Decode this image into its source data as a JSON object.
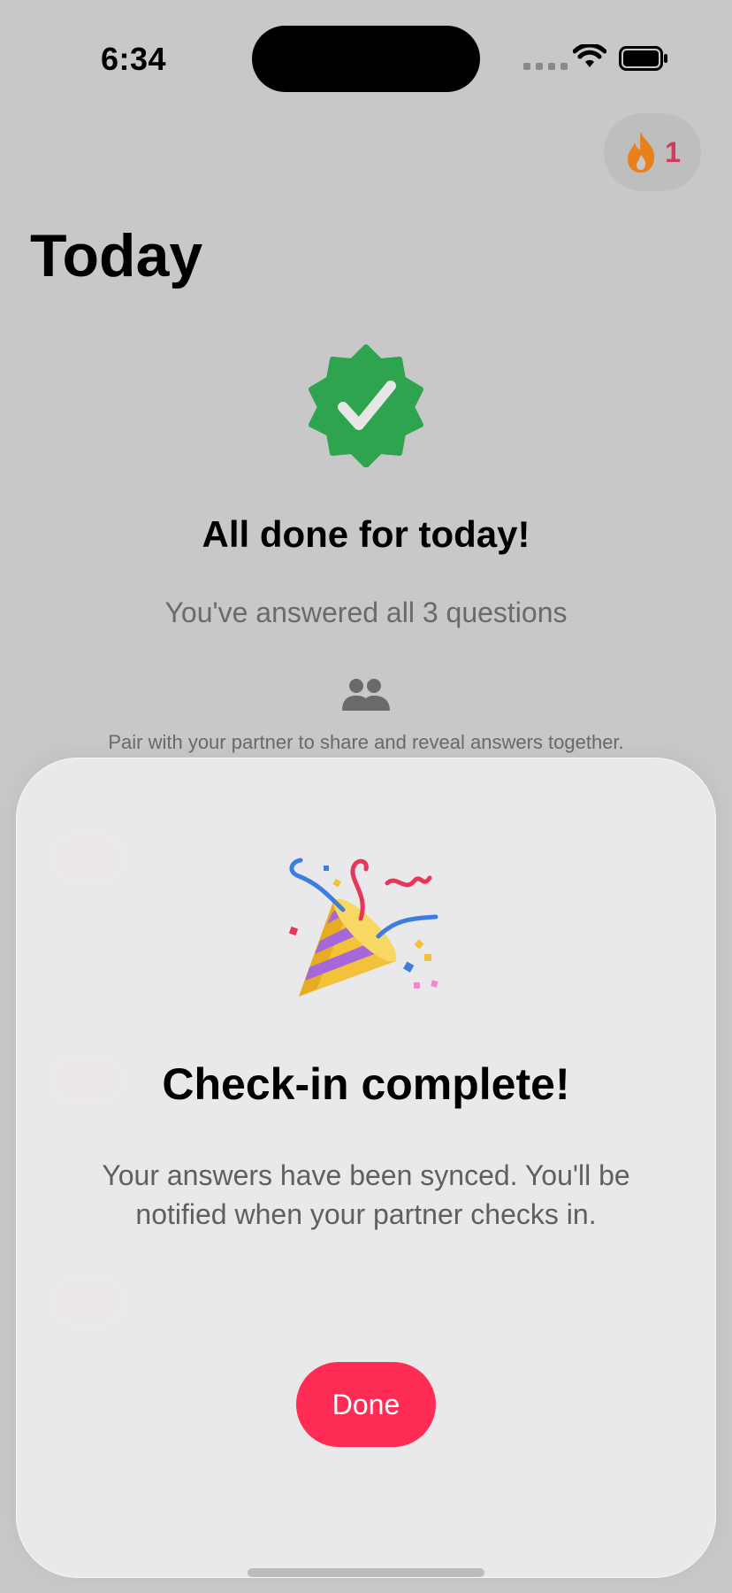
{
  "status_bar": {
    "time": "6:34"
  },
  "streak": {
    "icon": "flame-icon",
    "count": "1"
  },
  "page": {
    "title": "Today"
  },
  "summary": {
    "badge_icon": "checkmark-seal-icon",
    "heading": "All done for today!",
    "subtitle": "You've answered all 3 questions",
    "pair_icon": "people-icon",
    "pair_text": "Pair with your partner to share and reveal answers together."
  },
  "sheet": {
    "emoji": "party-popper-icon",
    "title": "Check-in complete!",
    "message": "Your answers have been synced. You'll be notified when your partner checks in.",
    "done_label": "Done"
  },
  "colors": {
    "accent": "#ff2d55",
    "success": "#2ea44f",
    "flame": "#e8801e",
    "streak_text": "#d23a5a"
  }
}
